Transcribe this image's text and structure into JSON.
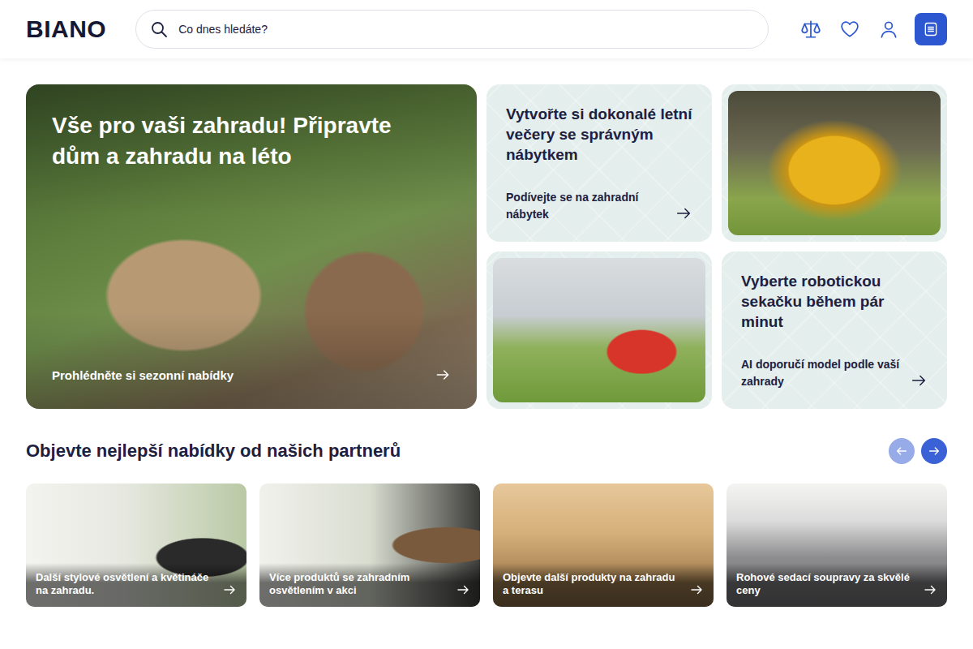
{
  "header": {
    "logo": "BIANO",
    "search": {
      "placeholder": "Co dnes hledáte?"
    }
  },
  "hero": {
    "main": {
      "title": "Vše pro vaši zahradu! Připravte dům a zahradu na léto",
      "link": "Prohlédněte si sezonní nabídky"
    },
    "tiles": [
      {
        "kind": "text",
        "title": "Vytvořte si dokonalé letní večery se správným nábytkem",
        "link": "Podívejte se na zahradní nábytek"
      },
      {
        "kind": "image"
      },
      {
        "kind": "image"
      },
      {
        "kind": "text",
        "title": "Vyberte robotickou sekačku během pár minut",
        "link": "AI doporučí model podle vaší zahrady"
      }
    ]
  },
  "partners": {
    "title": "Objevte nejlepší nabídky od našich partnerů",
    "prev": {
      "disabled": true
    },
    "next": {
      "disabled": false
    },
    "cards": [
      {
        "caption": "Další stylové osvětlení a květináče na zahradu."
      },
      {
        "caption": "Více produktů se zahradním osvětlením v akci"
      },
      {
        "caption": "Objevte další produkty na zahradu a terasu"
      },
      {
        "caption": "Rohové sedací soupravy za skvělé ceny"
      }
    ]
  }
}
